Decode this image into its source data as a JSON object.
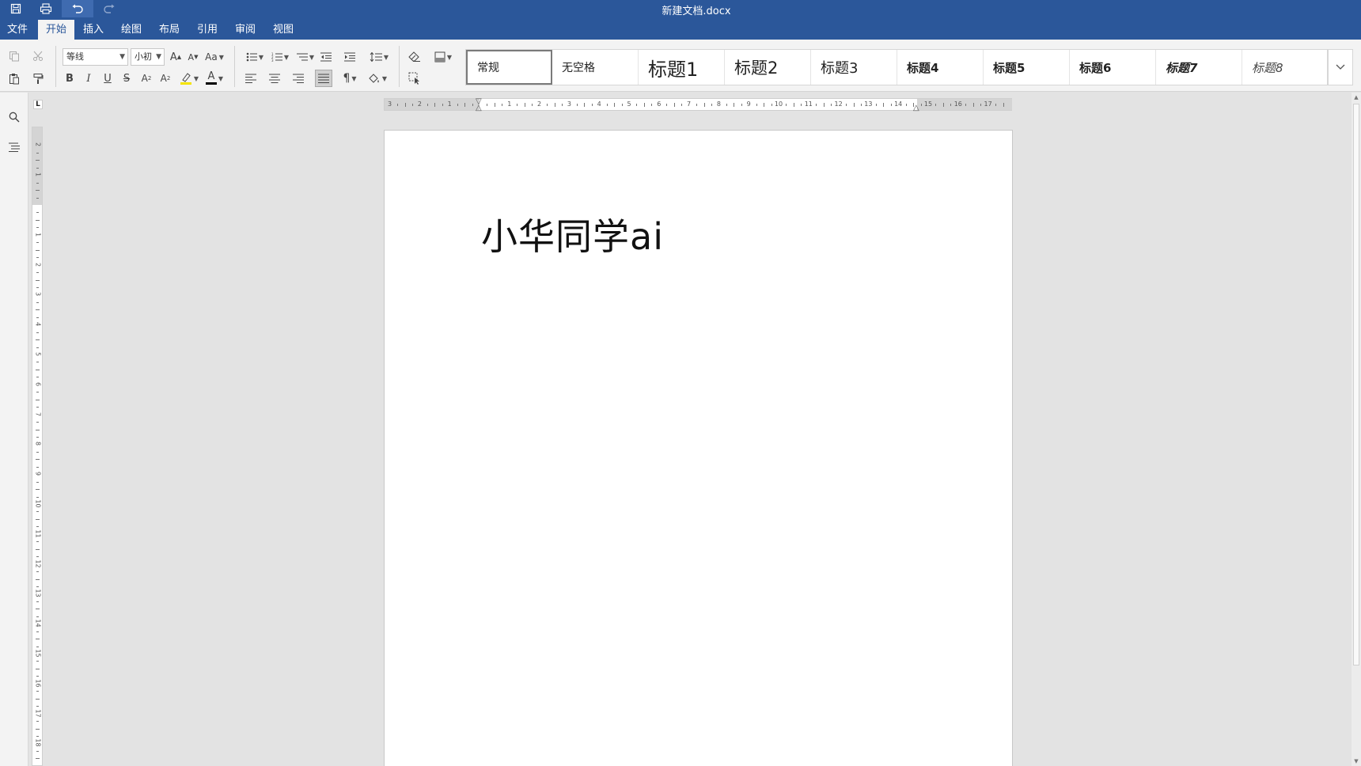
{
  "window": {
    "title": "新建文档.docx"
  },
  "quick_access": {
    "save_icon": "save-icon",
    "print_icon": "print-icon",
    "undo_icon": "undo-icon",
    "redo_icon": "redo-icon"
  },
  "menu": {
    "tabs": [
      {
        "label": "文件"
      },
      {
        "label": "开始",
        "active": true
      },
      {
        "label": "插入"
      },
      {
        "label": "绘图"
      },
      {
        "label": "布局"
      },
      {
        "label": "引用"
      },
      {
        "label": "审阅"
      },
      {
        "label": "视图"
      }
    ]
  },
  "ribbon": {
    "font_name": "等线",
    "font_size": "小初",
    "grow_font_label": "A",
    "shrink_font_label": "A",
    "change_case_label": "Aa",
    "bold_label": "B",
    "italic_label": "I",
    "underline_label": "U",
    "strikethrough_label": "S",
    "superscript_label": "A",
    "subscript_label": "A",
    "font_color_label": "A",
    "pilcrow_label": "¶",
    "highlight_color": "#f5e400",
    "font_color": "#000000"
  },
  "styles": {
    "items": [
      {
        "label": "常规",
        "selected": true
      },
      {
        "label": "无空格"
      },
      {
        "label": "标题1"
      },
      {
        "label": "标题2"
      },
      {
        "label": "标题3"
      },
      {
        "label": "标题4"
      },
      {
        "label": "标题5"
      },
      {
        "label": "标题6"
      },
      {
        "label": "标题7"
      },
      {
        "label": "标题8"
      }
    ]
  },
  "ruler": {
    "tab_selector": "L",
    "horizontal_numbers": [
      "3",
      "2",
      "1",
      "1",
      "2",
      "3",
      "4",
      "5",
      "6",
      "7",
      "8",
      "9",
      "10",
      "11",
      "12",
      "13",
      "14",
      "15",
      "16",
      "17"
    ],
    "vertical_numbers": [
      "2",
      "1",
      "1",
      "2",
      "3",
      "4",
      "5",
      "6",
      "7",
      "8",
      "9",
      "10",
      "11",
      "12",
      "13",
      "14",
      "15",
      "16",
      "17",
      "18"
    ]
  },
  "document": {
    "text": "小华同学ai"
  },
  "colors": {
    "accent": "#2b579a",
    "ribbon_bg": "#f3f3f3",
    "canvas_bg": "#e3e3e3"
  }
}
